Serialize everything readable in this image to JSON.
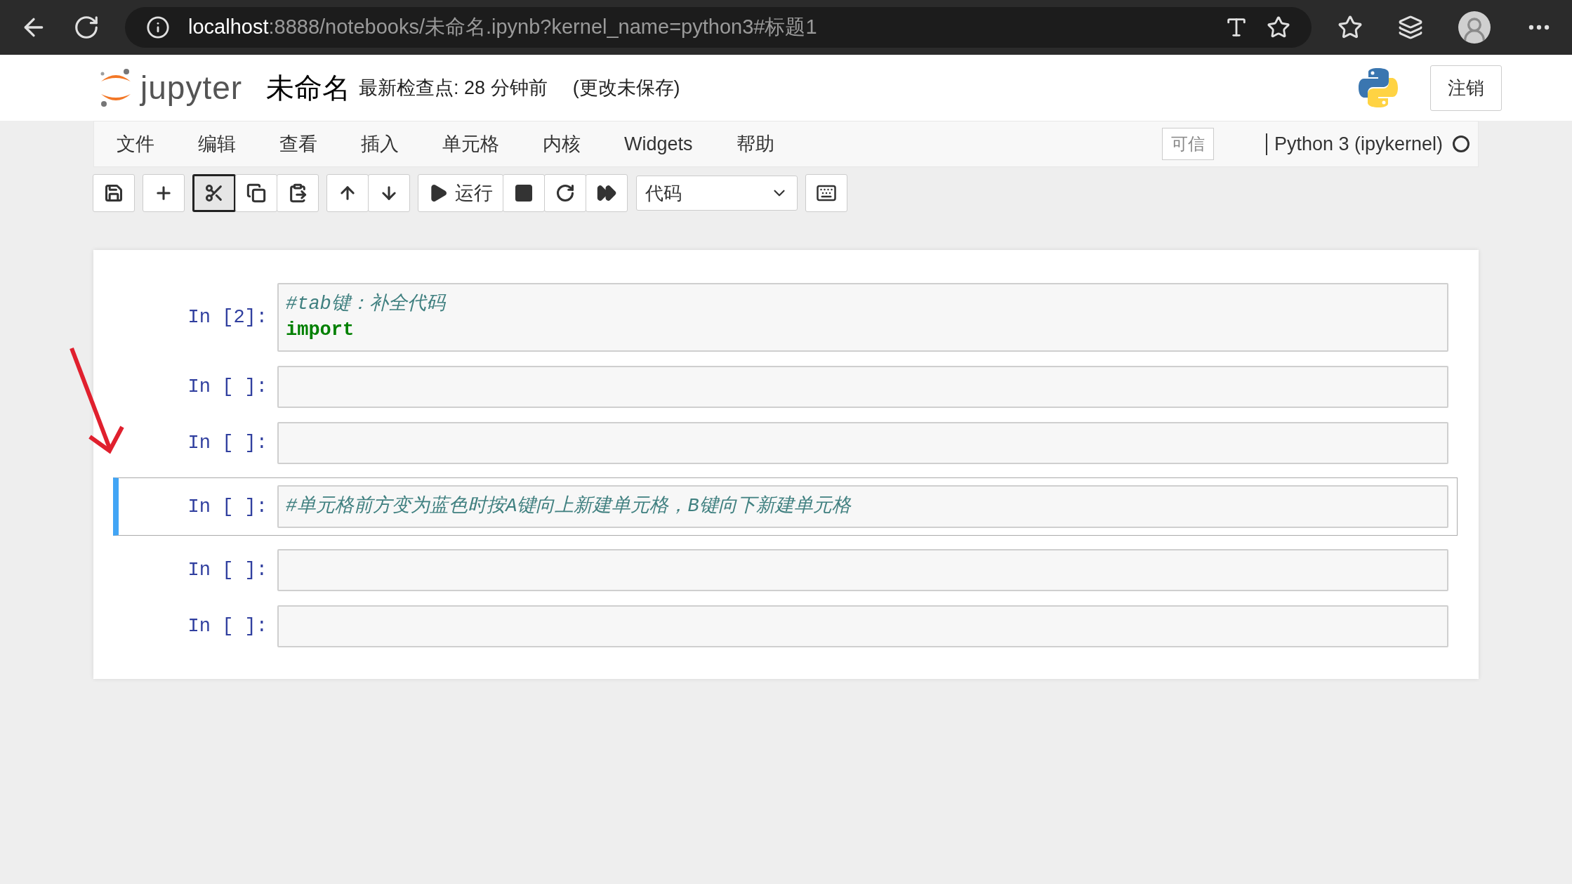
{
  "browser": {
    "url_host": "localhost",
    "url_path": ":8888/notebooks/未命名.ipynb?kernel_name=python3#标题1"
  },
  "header": {
    "logo_text": "jupyter",
    "notebook_name": "未命名",
    "checkpoint": "最新检查点: 28 分钟前",
    "autosave_status": "(更改未保存)",
    "logout_button": "注销"
  },
  "menubar": {
    "items": [
      "文件",
      "编辑",
      "查看",
      "插入",
      "单元格",
      "内核",
      "Widgets",
      "帮助"
    ],
    "trusted_badge": "可信",
    "kernel_name": "Python 3 (ipykernel)",
    "kernel_busy": false
  },
  "toolbar": {
    "groups": [
      [
        {
          "kind": "save",
          "focused": false
        }
      ],
      [
        {
          "kind": "plus",
          "focused": false
        }
      ],
      [
        {
          "kind": "cut",
          "focused": true
        },
        {
          "kind": "copy",
          "focused": false
        },
        {
          "kind": "paste",
          "focused": false
        }
      ],
      [
        {
          "kind": "up",
          "focused": false
        },
        {
          "kind": "down",
          "focused": false
        }
      ],
      [
        {
          "kind": "run",
          "label": "运行",
          "focused": false
        },
        {
          "kind": "stop",
          "focused": false
        },
        {
          "kind": "restart",
          "focused": false
        },
        {
          "kind": "forward",
          "focused": false
        }
      ]
    ],
    "cell_type": "代码"
  },
  "cells": [
    {
      "prompt": "In [2]:",
      "selected": false,
      "lines": [
        {
          "kind": "comment",
          "text": "#tab键：补全代码"
        },
        {
          "kind": "keyword",
          "text": "import"
        }
      ]
    },
    {
      "prompt": "In [ ]:",
      "selected": false
    },
    {
      "prompt": "In [ ]:",
      "selected": false
    },
    {
      "prompt": "In [ ]:",
      "selected": true,
      "lines": [
        {
          "kind": "comment",
          "text": "#单元格前方变为蓝色时按A键向上新建单元格，B键向下新建单元格"
        }
      ]
    },
    {
      "prompt": "In [ ]:",
      "selected": false
    },
    {
      "prompt": "In [ ]:",
      "selected": false
    }
  ]
}
